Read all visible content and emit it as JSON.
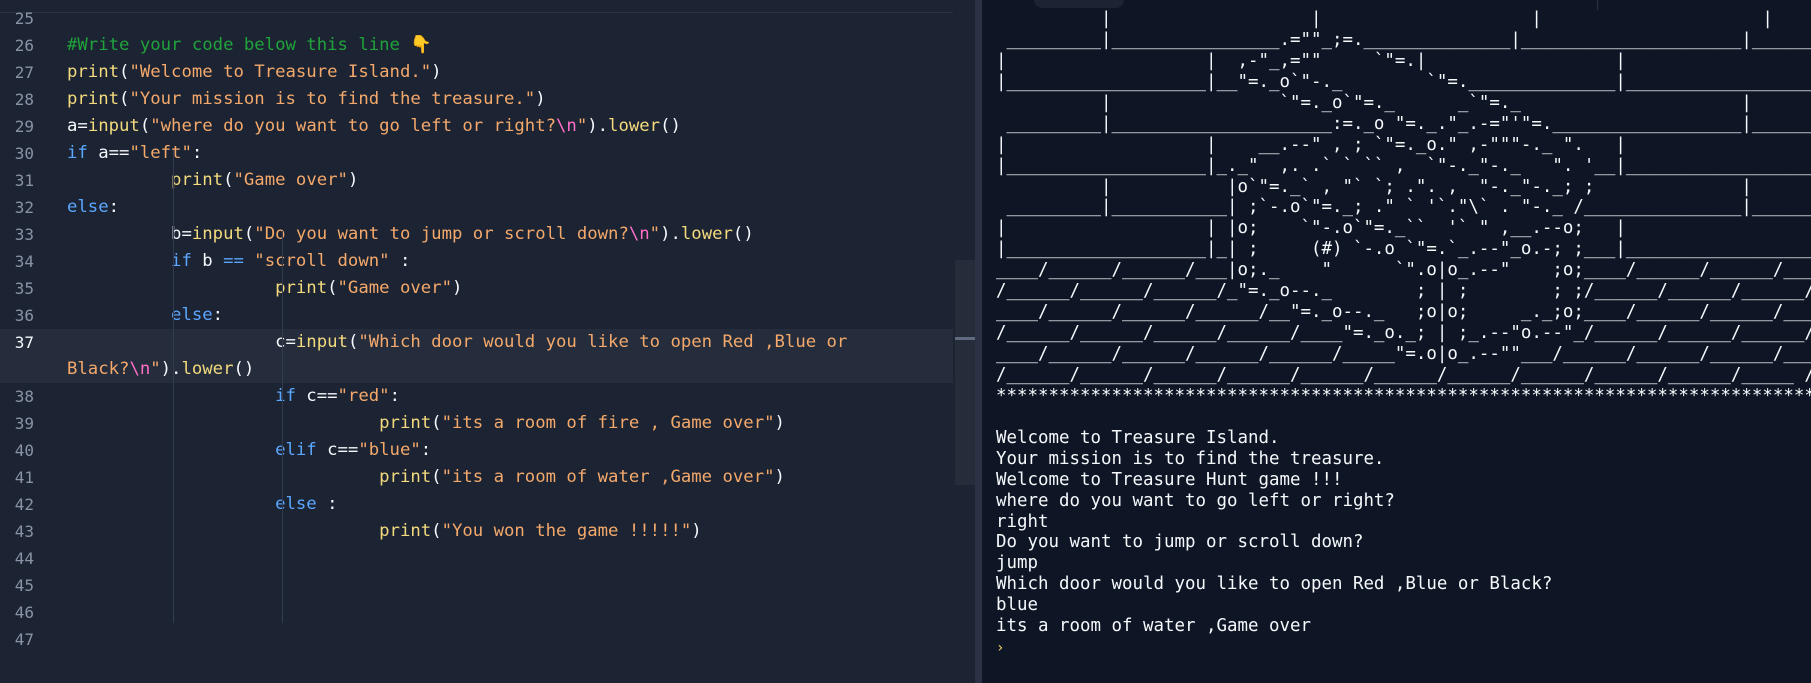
{
  "editor": {
    "lines": [
      {
        "n": "25",
        "segs": []
      },
      {
        "n": "26",
        "segs": [
          {
            "c": "c-comment",
            "t": "#Write your code below this line 👇"
          }
        ]
      },
      {
        "n": "27",
        "segs": [
          {
            "c": "c-func",
            "t": "print"
          },
          {
            "c": "c-plain",
            "t": "("
          },
          {
            "c": "c-str",
            "t": "\"Welcome to Treasure Island.\""
          },
          {
            "c": "c-plain",
            "t": ")"
          }
        ]
      },
      {
        "n": "28",
        "segs": [
          {
            "c": "c-func",
            "t": "print"
          },
          {
            "c": "c-plain",
            "t": "("
          },
          {
            "c": "c-str",
            "t": "\"Your mission is to find the treasure.\""
          },
          {
            "c": "c-plain",
            "t": ")"
          }
        ]
      },
      {
        "n": "29",
        "segs": [
          {
            "c": "c-plain",
            "t": "a="
          },
          {
            "c": "c-func",
            "t": "input"
          },
          {
            "c": "c-plain",
            "t": "("
          },
          {
            "c": "c-str",
            "t": "\"where do you want to go left or right?"
          },
          {
            "c": "c-esc",
            "t": "\\n"
          },
          {
            "c": "c-str",
            "t": "\""
          },
          {
            "c": "c-plain",
            "t": ")."
          },
          {
            "c": "c-func",
            "t": "lower"
          },
          {
            "c": "c-plain",
            "t": "()"
          }
        ]
      },
      {
        "n": "30",
        "segs": [
          {
            "c": "c-kw",
            "t": "if"
          },
          {
            "c": "c-plain",
            "t": " a=="
          },
          {
            "c": "c-str",
            "t": "\"left\""
          },
          {
            "c": "c-plain",
            "t": ":"
          }
        ]
      },
      {
        "n": "31",
        "segs": [
          {
            "c": "c-plain",
            "t": "          "
          },
          {
            "c": "c-func",
            "t": "print"
          },
          {
            "c": "c-plain",
            "t": "("
          },
          {
            "c": "c-str",
            "t": "\"Game over\""
          },
          {
            "c": "c-plain",
            "t": ")"
          }
        ]
      },
      {
        "n": "32",
        "segs": [
          {
            "c": "c-kw",
            "t": "else"
          },
          {
            "c": "c-plain",
            "t": ":"
          }
        ]
      },
      {
        "n": "33",
        "segs": [
          {
            "c": "c-plain",
            "t": "          b="
          },
          {
            "c": "c-func",
            "t": "input"
          },
          {
            "c": "c-plain",
            "t": "("
          },
          {
            "c": "c-str",
            "t": "\"Do you want to jump or scroll down?"
          },
          {
            "c": "c-esc",
            "t": "\\n"
          },
          {
            "c": "c-str",
            "t": "\""
          },
          {
            "c": "c-plain",
            "t": ")."
          },
          {
            "c": "c-func",
            "t": "lower"
          },
          {
            "c": "c-plain",
            "t": "()"
          }
        ]
      },
      {
        "n": "34",
        "segs": [
          {
            "c": "c-plain",
            "t": "          "
          },
          {
            "c": "c-kw",
            "t": "if"
          },
          {
            "c": "c-plain",
            "t": " b "
          },
          {
            "c": "c-kw",
            "t": "=="
          },
          {
            "c": "c-plain",
            "t": " "
          },
          {
            "c": "c-str",
            "t": "\"scroll down\""
          },
          {
            "c": "c-plain",
            "t": " :"
          }
        ]
      },
      {
        "n": "35",
        "segs": [
          {
            "c": "c-plain",
            "t": "                    "
          },
          {
            "c": "c-func",
            "t": "print"
          },
          {
            "c": "c-plain",
            "t": "("
          },
          {
            "c": "c-str",
            "t": "\"Game over\""
          },
          {
            "c": "c-plain",
            "t": ")"
          }
        ]
      },
      {
        "n": "36",
        "segs": [
          {
            "c": "c-plain",
            "t": "          "
          },
          {
            "c": "c-kw",
            "t": "else"
          },
          {
            "c": "c-plain",
            "t": ":"
          }
        ]
      },
      {
        "n": "37",
        "active": true,
        "segs": [
          {
            "c": "c-plain",
            "t": "                    c="
          },
          {
            "c": "c-func",
            "t": "input"
          },
          {
            "c": "c-plain",
            "t": "("
          },
          {
            "c": "c-str",
            "t": "\"Which door would you like to open Red ,Blue or"
          }
        ],
        "wrap": [
          {
            "c": "c-str",
            "t": "Black?"
          },
          {
            "c": "c-esc",
            "t": "\\n"
          },
          {
            "c": "c-str",
            "t": "\""
          },
          {
            "c": "c-plain",
            "t": ")."
          },
          {
            "c": "c-func",
            "t": "lower"
          },
          {
            "c": "c-plain",
            "t": "()"
          }
        ]
      },
      {
        "n": "38",
        "segs": [
          {
            "c": "c-plain",
            "t": "                    "
          },
          {
            "c": "c-kw",
            "t": "if"
          },
          {
            "c": "c-plain",
            "t": " c=="
          },
          {
            "c": "c-str",
            "t": "\"red\""
          },
          {
            "c": "c-plain",
            "t": ":"
          }
        ]
      },
      {
        "n": "39",
        "segs": [
          {
            "c": "c-plain",
            "t": "                              "
          },
          {
            "c": "c-func",
            "t": "print"
          },
          {
            "c": "c-plain",
            "t": "("
          },
          {
            "c": "c-str",
            "t": "\"its a room of fire , Game over\""
          },
          {
            "c": "c-plain",
            "t": ")"
          }
        ]
      },
      {
        "n": "40",
        "segs": [
          {
            "c": "c-plain",
            "t": "                    "
          },
          {
            "c": "c-kw",
            "t": "elif"
          },
          {
            "c": "c-plain",
            "t": " c=="
          },
          {
            "c": "c-str",
            "t": "\"blue\""
          },
          {
            "c": "c-plain",
            "t": ":"
          }
        ]
      },
      {
        "n": "41",
        "segs": [
          {
            "c": "c-plain",
            "t": "                              "
          },
          {
            "c": "c-func",
            "t": "print"
          },
          {
            "c": "c-plain",
            "t": "("
          },
          {
            "c": "c-str",
            "t": "\"its a room of water ,Game over\""
          },
          {
            "c": "c-plain",
            "t": ")"
          }
        ]
      },
      {
        "n": "42",
        "segs": [
          {
            "c": "c-plain",
            "t": "                    "
          },
          {
            "c": "c-kw",
            "t": "else"
          },
          {
            "c": "c-plain",
            "t": " :"
          }
        ]
      },
      {
        "n": "43",
        "segs": [
          {
            "c": "c-plain",
            "t": "                              "
          },
          {
            "c": "c-func",
            "t": "print"
          },
          {
            "c": "c-plain",
            "t": "("
          },
          {
            "c": "c-str",
            "t": "\"You won the game !!!!!\""
          },
          {
            "c": "c-plain",
            "t": ")"
          }
        ]
      },
      {
        "n": "44",
        "segs": []
      },
      {
        "n": "45",
        "segs": []
      },
      {
        "n": "46",
        "segs": []
      },
      {
        "n": "47",
        "segs": []
      }
    ]
  },
  "console": {
    "ascii_art": "          |                   |                    |                     |\n _________|________________.=\"\"_;=.______________|_____________________|_______\n|                   |  ,-\"_,=\"\"     `\"=.|                  |\n|___________________|__\"=._o`\"-._        `\"=.______________|___________________\n          |                `\"=._o`\"=._      _`\"=._                     |\n _________|_____________________:=._o \"=._.\"_.-=\"'\"=.__________________|_______\n|                   |    __.--\" , ; `\"=._o.\" ,-\"\"\"-._ \".   |\n|___________________|_._\"  ,. .` ` `` ,  `\"-._\"-._   \". '__|___________________\n          |           |o`\"=._` , \"` `; .\". ,  \"-._\"-._; ;              |\n _________|___________| ;`-.o`\"=._; .\" ` '`.\"\\` . \"-._ /_______________|_______\n|                   | |o;    `\"-.o`\"=._``  '` \" ,__.--o;   |\n|___________________|_| ;     (#) `-.o `\"=.`_.--\"_o.-; ;___|___________________\n____/______/______/___|o;._    \"      `\".o|o_.--\"    ;o;____/______/______/____\n/______/______/______/_\"=._o--._        ; | ;        ; ;/______/______/______/_\n____/______/______/______/__\"=._o--._   ;o|o;     _._;o;____/______/______/____\n/______/______/______/______/____\"=._o._; | ;_.--\"o.--\"_/______/______/______/_\n____/______/______/______/______/_____\"=.o|o_.--\"\"___/______/______/______/____\n/______/______/______/______/______/______/______/______/______/______/_____ /\n*******************************************************************************\n\nWelcome to Treasure Island.\nYour mission is to find the treasure.\nWelcome to Treasure Hunt game !!!\nwhere do you want to go left or right?\nright\nDo you want to jump or scroll down?\njump\nWhich door would you like to open Red ,Blue or Black?\nblue\nits a room of water ,Game over",
    "prompt_glyph": "›"
  },
  "colors": {
    "editor_bg": "#1c2333",
    "console_bg": "#0e1525",
    "comment": "#20a33b",
    "function": "#f2da7d",
    "string": "#f4a96b",
    "keyword": "#5ba7ff",
    "escape": "#ff6ec7",
    "text": "#f5f9fc"
  }
}
